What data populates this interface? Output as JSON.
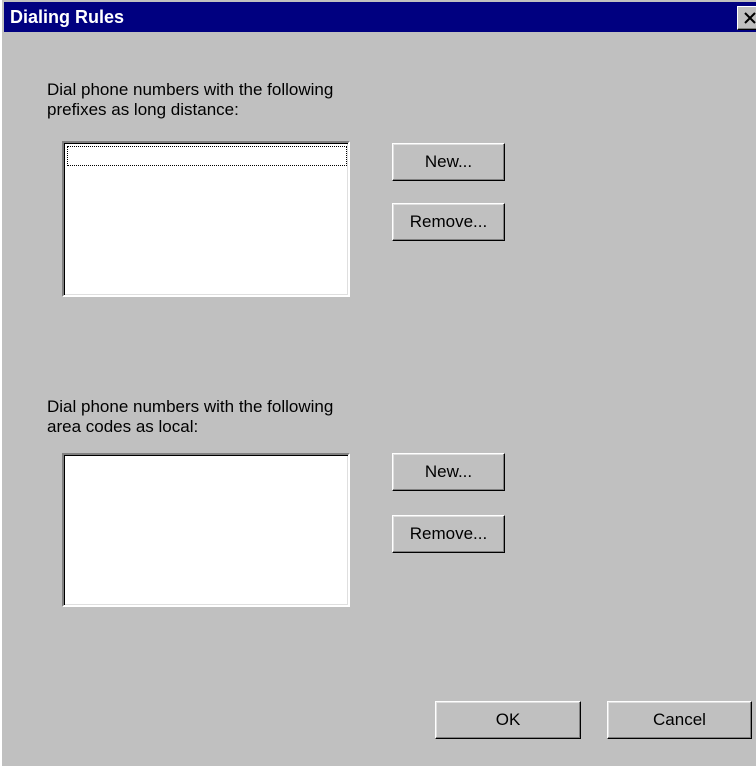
{
  "window": {
    "title": "Dialing Rules",
    "close_glyph": "close-icon",
    "titlebar_color": "#000080",
    "face_color": "#c0c0c0"
  },
  "long_distance": {
    "label_line1": "Dial phone numbers with the following",
    "label_line2": "prefixes as long distance:",
    "items": [],
    "new_label": "New...",
    "remove_label": "Remove..."
  },
  "local": {
    "label_line1": "Dial phone numbers with the following",
    "label_line2": "area codes as local:",
    "items": [],
    "new_label": "New...",
    "remove_label": "Remove..."
  },
  "footer": {
    "ok_label": "OK",
    "cancel_label": "Cancel"
  }
}
